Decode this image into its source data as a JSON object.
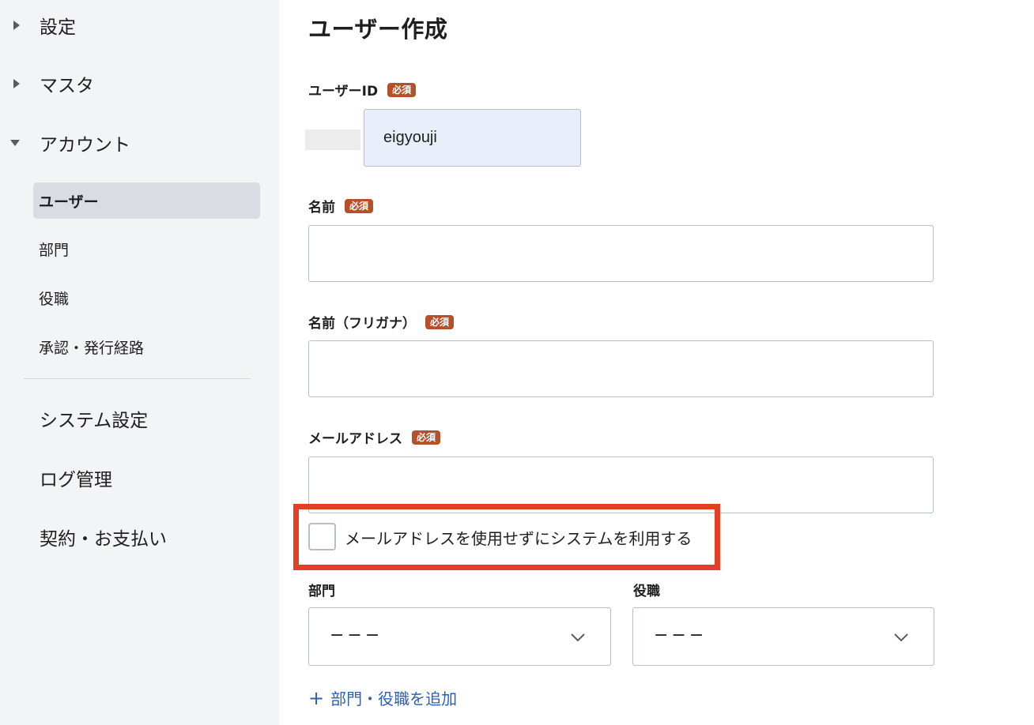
{
  "sidebar": {
    "groups": [
      {
        "label": "設定",
        "expanded": false
      },
      {
        "label": "マスタ",
        "expanded": false
      },
      {
        "label": "アカウント",
        "expanded": true
      }
    ],
    "account_items": [
      {
        "label": "ユーザー",
        "active": true
      },
      {
        "label": "部門",
        "active": false
      },
      {
        "label": "役職",
        "active": false
      },
      {
        "label": "承認・発行経路",
        "active": false
      }
    ],
    "top_items": [
      {
        "label": "システム設定"
      },
      {
        "label": "ログ管理"
      },
      {
        "label": "契約・お支払い"
      }
    ]
  },
  "main": {
    "title": "ユーザー作成",
    "required_badge": "必須",
    "fields": {
      "user_id": {
        "label": "ユーザーID",
        "value": "eigyouji"
      },
      "name": {
        "label": "名前",
        "value": ""
      },
      "name_kana": {
        "label": "名前（フリガナ）",
        "value": ""
      },
      "email": {
        "label": "メールアドレス",
        "value": ""
      }
    },
    "no_email_checkbox": {
      "label": "メールアドレスを使用せずにシステムを利用する",
      "checked": false
    },
    "department": {
      "label": "部門",
      "selected": "−−−"
    },
    "position": {
      "label": "役職",
      "selected": "−−−"
    },
    "add_link": {
      "icon": "+",
      "label": "部門・役職を追加"
    }
  },
  "colors": {
    "required_badge": "#b5502a",
    "highlight": "#e33f24",
    "link": "#2f5fb3",
    "active_nav": "#d9dce2"
  }
}
